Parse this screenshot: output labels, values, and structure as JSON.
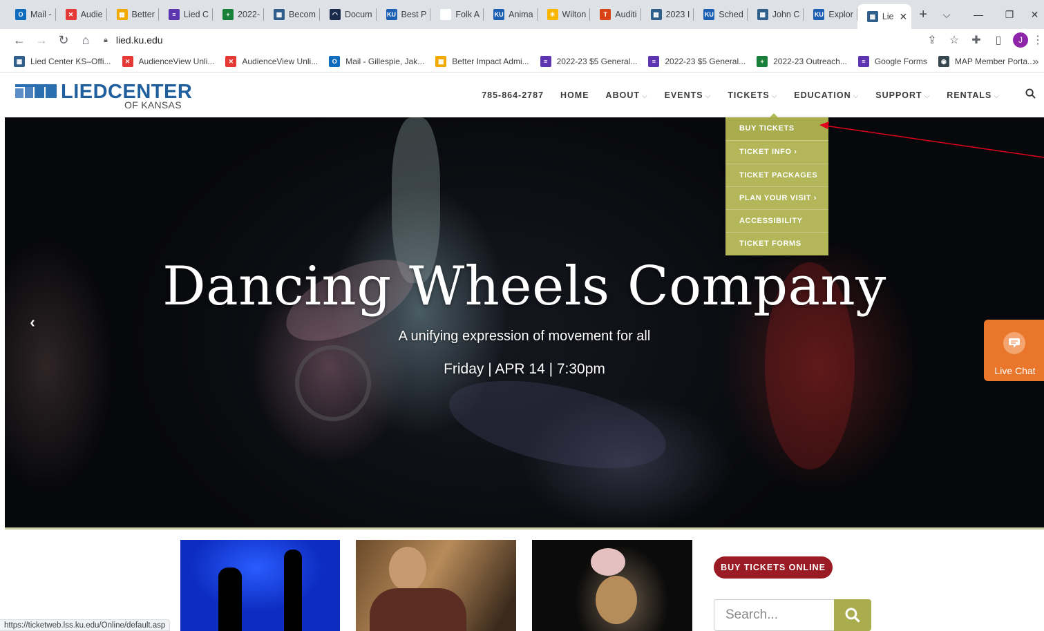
{
  "browser": {
    "tabs": [
      {
        "title": "Mail -",
        "color": "#0f6cbd",
        "glyph": "O"
      },
      {
        "title": "Audie",
        "color": "#e53935",
        "glyph": "✕"
      },
      {
        "title": "Better",
        "color": "#f2a900",
        "glyph": "▦"
      },
      {
        "title": "Lied C",
        "color": "#5e35b1",
        "glyph": "≡"
      },
      {
        "title": "2022-",
        "color": "#188038",
        "glyph": "+"
      },
      {
        "title": "Becom",
        "color": "#2f5f8a",
        "glyph": "▦"
      },
      {
        "title": "Docum",
        "color": "#1a2a4a",
        "glyph": "◠"
      },
      {
        "title": "Best P",
        "color": "#1a5fb4",
        "glyph": "KU"
      },
      {
        "title": "Folk A",
        "color": "#ffffff",
        "glyph": ""
      },
      {
        "title": "Anima",
        "color": "#1a5fb4",
        "glyph": "KU"
      },
      {
        "title": "Wilton",
        "color": "#f9b500",
        "glyph": "✳"
      },
      {
        "title": "Auditi",
        "color": "#d84315",
        "glyph": "T"
      },
      {
        "title": "2023 I",
        "color": "#2f5f8a",
        "glyph": "▦"
      },
      {
        "title": "Sched",
        "color": "#1a5fb4",
        "glyph": "KU"
      },
      {
        "title": "John C",
        "color": "#2f5f8a",
        "glyph": "▦"
      },
      {
        "title": "Explor",
        "color": "#1a5fb4",
        "glyph": "KU"
      }
    ],
    "active_tab": {
      "title": "Lie",
      "color": "#2f5f8a",
      "glyph": "▦"
    },
    "new_tab": "+",
    "url": "lied.ku.edu",
    "profile_initial": "J",
    "status_url": "https://ticketweb.lss.ku.edu/Online/default.asp"
  },
  "bookmarks": [
    {
      "label": "Lied Center KS–Offi...",
      "color": "#2f5f8a",
      "glyph": "▦"
    },
    {
      "label": "AudienceView Unli...",
      "color": "#e53935",
      "glyph": "✕"
    },
    {
      "label": "AudienceView Unli...",
      "color": "#e53935",
      "glyph": "✕"
    },
    {
      "label": "Mail - Gillespie, Jak...",
      "color": "#0f6cbd",
      "glyph": "O"
    },
    {
      "label": "Better Impact Admi...",
      "color": "#f2a900",
      "glyph": "▦"
    },
    {
      "label": "2022-23 $5 General...",
      "color": "#5e35b1",
      "glyph": "≡"
    },
    {
      "label": "2022-23 $5 General...",
      "color": "#5e35b1",
      "glyph": "≡"
    },
    {
      "label": "2022-23 Outreach...",
      "color": "#188038",
      "glyph": "+"
    },
    {
      "label": "Google Forms",
      "color": "#5e35b1",
      "glyph": "≡"
    },
    {
      "label": "MAP Member Porta...",
      "color": "#37474f",
      "glyph": "◉"
    }
  ],
  "site": {
    "logo_title": "LIEDCENTER",
    "logo_sub": "OF KANSAS",
    "phone": "785-864-2787",
    "nav": [
      {
        "label": "HOME",
        "chev": ""
      },
      {
        "label": "ABOUT",
        "chev": "⌵"
      },
      {
        "label": "EVENTS",
        "chev": "⌵"
      },
      {
        "label": "TICKETS",
        "chev": "⌵"
      },
      {
        "label": "EDUCATION",
        "chev": "⌵"
      },
      {
        "label": "SUPPORT",
        "chev": "⌵"
      },
      {
        "label": "RENTALS",
        "chev": "⌵"
      }
    ],
    "tickets_menu": [
      "BUY TICKETS",
      "TICKET INFO ›",
      "TICKET PACKAGES",
      "PLAN YOUR VISIT ›",
      "ACCESSIBILITY",
      "TICKET FORMS"
    ],
    "hero": {
      "title": "Dancing Wheels Company",
      "subtitle": "A unifying expression of movement for all",
      "date": "Friday | APR 14 | 7:30pm"
    },
    "live_chat": "Live Chat",
    "buy_online": "BUY TICKETS ONLINE",
    "search_placeholder": "Search..."
  },
  "colors": {
    "accent_olive": "#b3b75a",
    "brand_blue": "#1f5f9e",
    "buy_red": "#9b1b24",
    "chat_orange": "#e9762b",
    "annotation_red": "#e0001b"
  }
}
